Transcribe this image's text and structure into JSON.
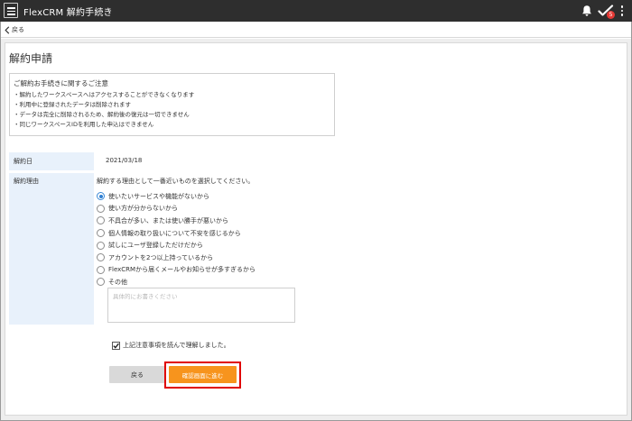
{
  "app": {
    "title": "FlexCRM 解約手続き",
    "badge_count": "5"
  },
  "nav": {
    "back_label": "戻る"
  },
  "page": {
    "title": "解約申請"
  },
  "notice": {
    "heading": "ご解約お手続きに関するご注意",
    "items": [
      "・解約したワークスペースへはアクセスすることができなくなります",
      "・利用中に登録されたデータは削除されます",
      "・データは完全に削除されるため、解約後の復元は一切できません",
      "・同じワークスペースIDを利用した申込はできません"
    ]
  },
  "form": {
    "date_label": "解約日",
    "date_value": "2021/03/18",
    "reason_label": "解約理由",
    "reason_instruction": "解約する理由として一番近いものを選択してください。",
    "reasons": [
      "使いたいサービスや機能がないから",
      "使い方が分からないから",
      "不具合が多い、または使い勝手が悪いから",
      "個人情報の取り扱いについて不安を感じるから",
      "試しにユーザ登録しただけだから",
      "アカウントを2つ以上持っているから",
      "FlexCRMから届くメールやお知らせが多すぎるから",
      "その他"
    ],
    "selected_reason": "使いたいサービスや機能がないから",
    "other_placeholder": "具体的にお書きください",
    "other_value": "",
    "agree_label": "上記注意事項を読んで理解しました。",
    "agree_checked": true
  },
  "buttons": {
    "back_label": "戻る",
    "confirm_label": "確認画面に進む"
  },
  "colors": {
    "header_bg": "#2e2e2e",
    "label_bg": "#e8f1fb",
    "confirm_button": "#f7941d",
    "highlight": "#e00000",
    "radio_selected": "#2f7fd2",
    "badge": "#e53935"
  },
  "icons": [
    "menu-icon",
    "bell-icon",
    "checkmark-icon",
    "more-vertical-icon",
    "chevron-left-icon",
    "checkbox-checked-icon"
  ]
}
